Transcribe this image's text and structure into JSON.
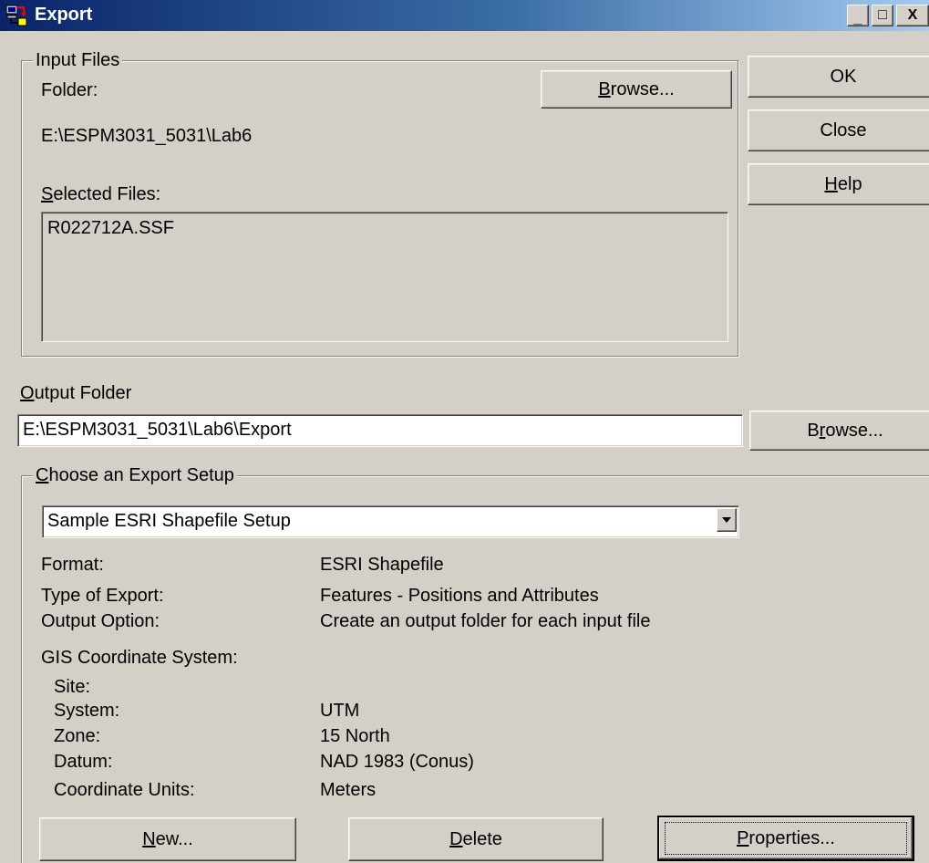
{
  "window": {
    "title": "Export",
    "minimize_glyph": "_",
    "maximize_glyph": "□",
    "close_glyph": "X"
  },
  "input_files": {
    "group_label": "Input Files",
    "folder_label": "Folder:",
    "folder_value": "E:\\ESPM3031_5031\\Lab6",
    "browse_label_pre": "",
    "browse_label_key": "B",
    "browse_label_post": "rowse...",
    "selected_files_key": "S",
    "selected_files_post": "elected Files:",
    "files": [
      "R022712A.SSF"
    ]
  },
  "dialog_buttons": {
    "ok": "OK",
    "close": "Close",
    "help_key": "H",
    "help_post": "elp"
  },
  "output": {
    "label_key": "O",
    "label_post": "utput Folder",
    "value": "E:\\ESPM3031_5031\\Lab6\\Export",
    "browse_label_pre": "B",
    "browse_label_key": "r",
    "browse_label_post": "owse..."
  },
  "export_setup": {
    "group_label_key": "C",
    "group_label_post": "hoose an Export Setup",
    "selected": "Sample ESRI Shapefile Setup",
    "rows": [
      {
        "label": "Format:",
        "value": "ESRI Shapefile"
      },
      {
        "label": "Type of Export:",
        "value": "Features - Positions and Attributes"
      },
      {
        "label": "Output Option:",
        "value": "Create an output folder for each input file"
      }
    ],
    "gis_label": "GIS Coordinate System:",
    "gis_rows": [
      {
        "label": "Site:",
        "value": ""
      },
      {
        "label": "System:",
        "value": "UTM"
      },
      {
        "label": "Zone:",
        "value": "15 North"
      },
      {
        "label": "Datum:",
        "value": "NAD 1983 (Conus)"
      },
      {
        "label": "Coordinate Units:",
        "value": "Meters"
      }
    ],
    "new_key": "N",
    "new_post": "ew...",
    "delete_key": "D",
    "delete_post": "elete",
    "properties_key": "P",
    "properties_post": "roperties..."
  }
}
